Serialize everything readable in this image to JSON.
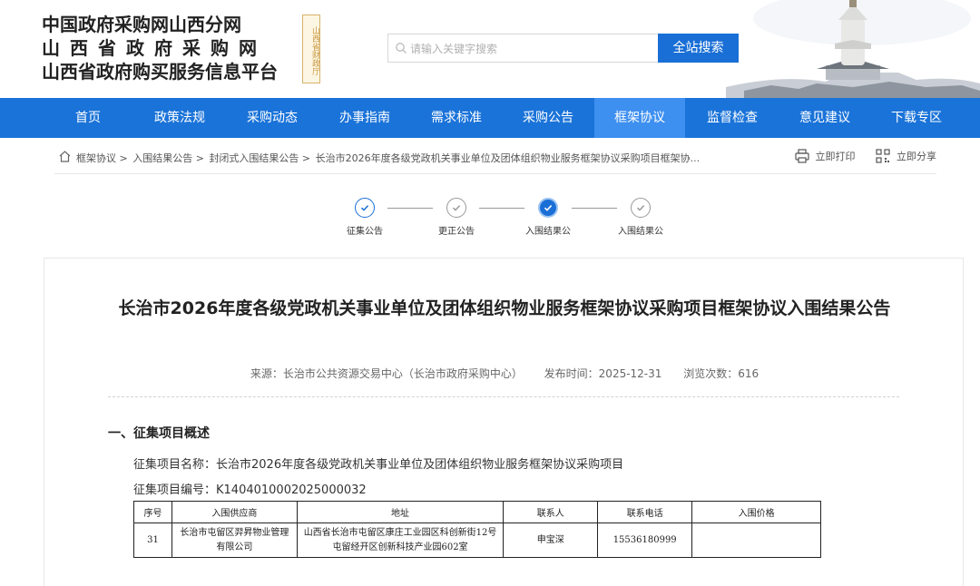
{
  "header": {
    "logo_lines": [
      "中国政府采购网山西分网",
      "山西省政府采购网",
      "山西省政府购买服务信息平台"
    ],
    "seal_text": "山西省财政厅",
    "search_placeholder": "请输入关键字搜索",
    "search_button": "全站搜索"
  },
  "nav": {
    "items": [
      "首页",
      "政策法规",
      "采购动态",
      "办事指南",
      "需求标准",
      "采购公告",
      "框架协议",
      "监督检查",
      "意见建议",
      "下载专区"
    ],
    "active": "框架协议"
  },
  "breadcrumb": {
    "items": [
      "框架协议 >",
      "入围结果公告 >",
      "封闭式入围结果公告 >",
      "长治市2026年度各级党政机关事业单位及团体组织物业服务框架协议采购项目框架协..."
    ],
    "print": "立即打印",
    "share": "立即分享"
  },
  "steps": [
    {
      "label": "征集公告",
      "state": "done"
    },
    {
      "label": "更正公告",
      "state": "inactive"
    },
    {
      "label": "入围结果公",
      "state": "current"
    },
    {
      "label": "入围结果公",
      "state": "inactive"
    }
  ],
  "article": {
    "title": "长治市2026年度各级党政机关事业单位及团体组织物业服务框架协议采购项目框架协议入围结果公告",
    "source": "来源：长治市公共资源交易中心（长治市政府采购中心）",
    "publish_time": "发布时间：2025-12-31",
    "views": "浏览次数：616",
    "section_title": "一、征集项目概述",
    "project_name": "征集项目名称：长治市2026年度各级党政机关事业单位及团体组织物业服务框架协议采购项目",
    "project_code": "征集项目编号：K1404010002025000032"
  },
  "table": {
    "headers": [
      "序号",
      "入围供应商",
      "地址",
      "联系人",
      "联系电话",
      "入围价格"
    ],
    "rows": [
      [
        "31",
        "长治市屯留区羿昇物业管理有限公司",
        "山西省长治市屯留区康庄工业园区科创新街12号屯留经开区创新科技产业园602室",
        "申宝深",
        "15536180999",
        ""
      ]
    ]
  },
  "colors": {
    "nav_bg": "#1a73d9",
    "nav_active": "#3d8ff0",
    "search_button": "#1a6fd6",
    "step_accent": "#1a6fd6"
  }
}
